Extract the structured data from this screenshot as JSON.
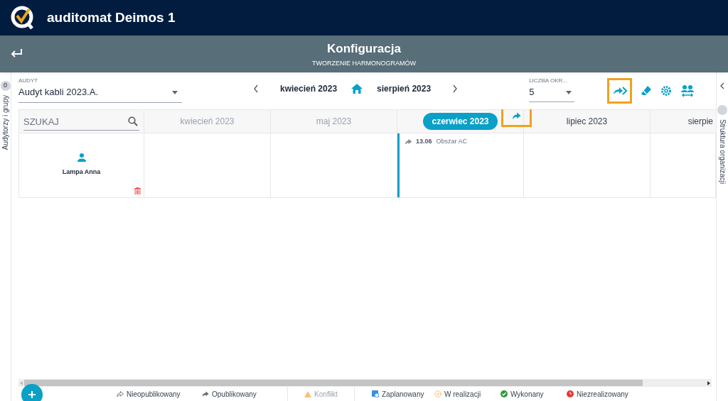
{
  "app": {
    "title": "auditomat Deimos 1"
  },
  "page": {
    "title": "Konfiguracja",
    "subtitle": "TWORZENIE HARMONOGRAMÓW"
  },
  "left_panel": {
    "label": "Audytorzy i grupy",
    "count": "0"
  },
  "right_panel": {
    "label": "Struktura organizacji"
  },
  "audit": {
    "label": "AUDYT",
    "value": "Audyt kabli 2023.A."
  },
  "nav": {
    "from": "kwiecień 2023",
    "to": "sierpień 2023"
  },
  "periods": {
    "label": "LICZBA OKR...",
    "value": "5"
  },
  "grid": {
    "search": {
      "placeholder": "SZUKAJ"
    },
    "columns": [
      {
        "label": "kwiecień 2023",
        "selected": false,
        "past": true
      },
      {
        "label": "maj 2023",
        "selected": false,
        "past": true
      },
      {
        "label": "czerwiec 2023",
        "selected": true,
        "past": false
      },
      {
        "label": "lipiec 2023",
        "selected": false,
        "past": false
      },
      {
        "label": "sierpie",
        "selected": false,
        "past": false
      }
    ],
    "rows": [
      {
        "name": "Lampa Anna",
        "cells": [
          [],
          [],
          [
            {
              "date": "13.06",
              "name": "Obszar AC",
              "published": true
            }
          ],
          [],
          []
        ]
      }
    ]
  },
  "legend": [
    {
      "kind": "unpublished",
      "label": "Nieopublikowany",
      "disabled": false
    },
    {
      "kind": "published",
      "label": "Opublikowany",
      "disabled": false
    },
    {
      "kind": "conflict",
      "label": "Konflikt",
      "disabled": true
    },
    {
      "kind": "planned",
      "label": "Zaplanowany",
      "disabled": false
    },
    {
      "kind": "in_progress",
      "label": "W realizacji",
      "disabled": false
    },
    {
      "kind": "done",
      "label": "Wykonany",
      "disabled": false
    },
    {
      "kind": "not_done",
      "label": "Niezrealizowany",
      "disabled": false
    }
  ]
}
